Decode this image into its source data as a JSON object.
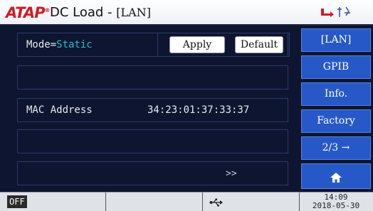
{
  "header": {
    "logo_main": "ATAP",
    "logo_reg": "®",
    "title": "DC Load -",
    "title_tag": "[LAN]"
  },
  "main": {
    "mode_label": "Mode=",
    "mode_value": "Static",
    "apply_label": "Apply",
    "default_label": "Default",
    "mac_label": "MAC Address",
    "mac_value": "34:23:01:37:33:37",
    "more_label": ">>"
  },
  "side_menu": {
    "items": [
      {
        "label": "[LAN]"
      },
      {
        "label": "GPIB"
      },
      {
        "label": "Info."
      },
      {
        "label": "Factory"
      },
      {
        "label": "2/3 →"
      }
    ]
  },
  "status_bar": {
    "output_state": "OFF",
    "time": "14:09",
    "date": "2018-05-30"
  },
  "colors": {
    "panel_bg": "#0d1530",
    "menu_button": "#2758c8",
    "mode_value": "#23c0cd",
    "logo_red": "#d21a24"
  }
}
